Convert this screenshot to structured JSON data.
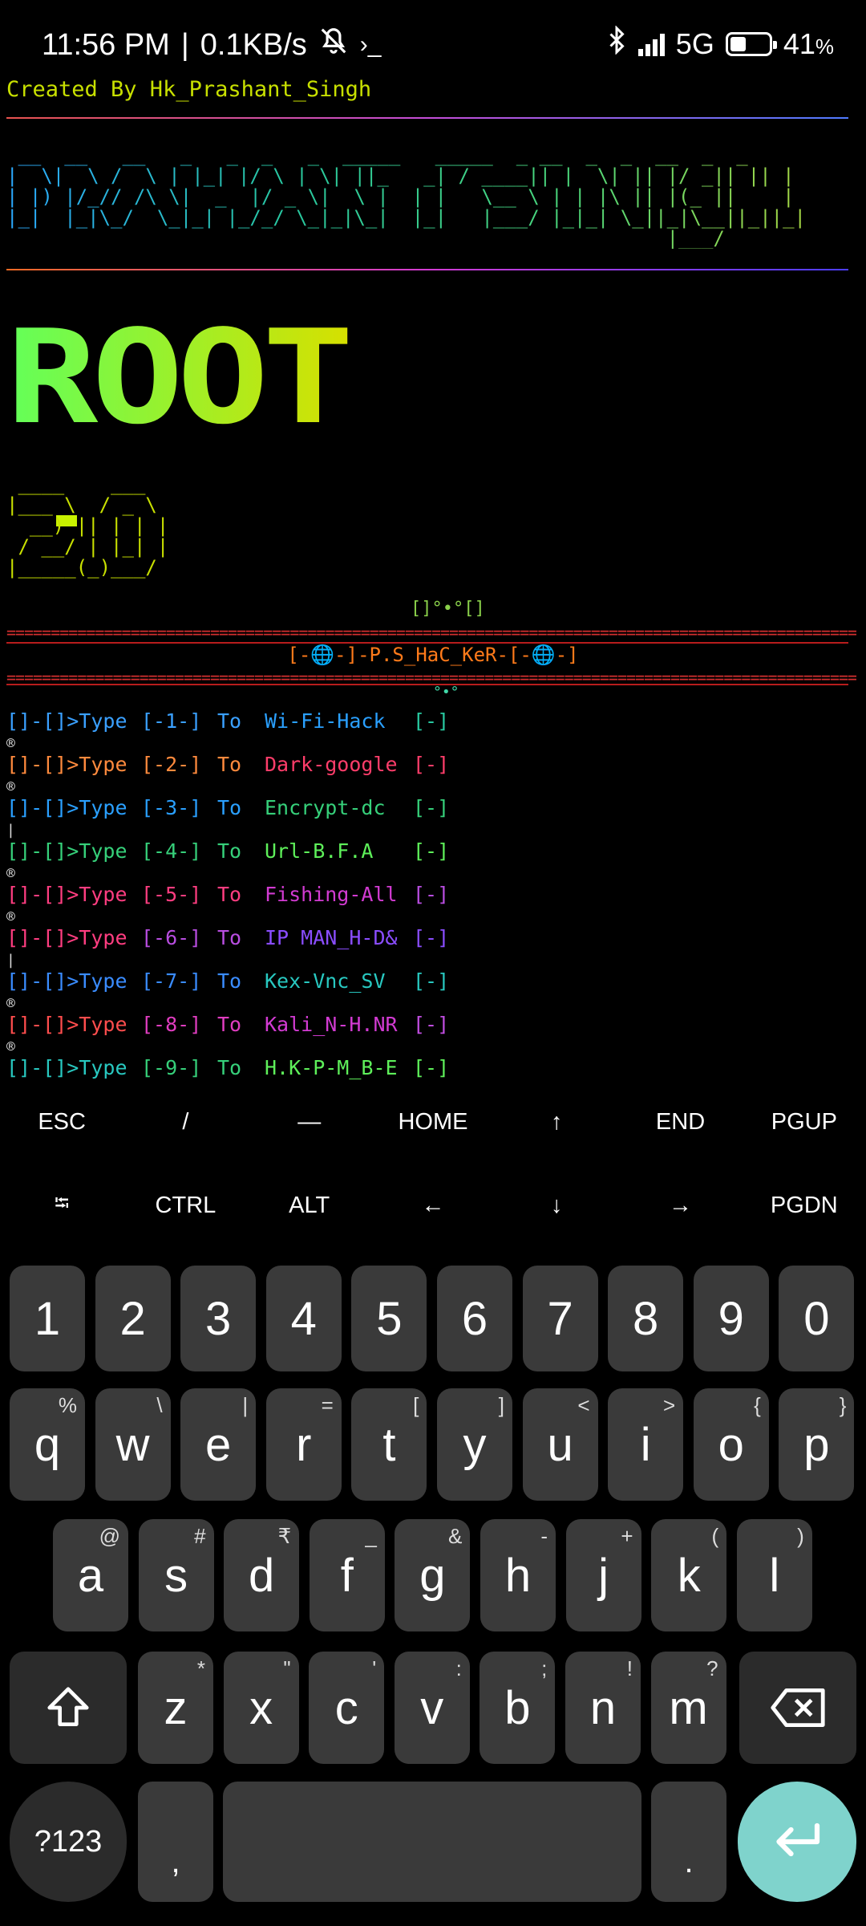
{
  "status_bar": {
    "time": "11:56 PM",
    "speed": "0.1KB/s",
    "network": "5G",
    "battery": "41",
    "battery_pct_symbol": "%",
    "battery_level": 0.41,
    "icons": [
      "mute-icon",
      "terminal-icon",
      "bluetooth-icon",
      "signal-icon",
      "battery-icon"
    ]
  },
  "terminal": {
    "credit": "Created By Hk_Prashant_Singh",
    "banner_ascii": " __  __   __   _   _  _   _  _____   _____  _ __  _  _  __  _  _ \n|  \\|  \\ /  \\ | |_| |/ \\ | \\| ||_   _| / ____|| |  \\| || |/ _|| || |\n| |) |/_// /\\ \\|  _  |/ _ \\|  \\ |  | |   \\__ \\ | | |\\ || |(_ ||    |\n|_|  |_|\\_/  \\_|_| |_/_/ \\_|_|\\_|  |_|   |___/ |_|_| \\_||_|\\__||_||_|\n                                                         |___/       ",
    "root_text": "ROOT",
    "version_ascii": " ____    ___  \n|___ \\  / _ \\ \n  __) || | | |\n / __/ | |_| |\n|_____(_)___/ ",
    "deco_top": "[]°•°[]",
    "separator": "==============================================================================================================",
    "header": "[-🌐-]-P.S_HaC_KeR-[-🌐-]",
    "deco_bottom": "°•°",
    "menu": [
      {
        "prefix": "[]-[]>Type",
        "num": "[-1-]",
        "to": "To",
        "name": "Wi-Fi-Hack",
        "end": "[-]",
        "mark": "®"
      },
      {
        "prefix": "[]-[]>Type",
        "num": "[-2-]",
        "to": "To",
        "name": "Dark-google",
        "end": "[-]",
        "mark": "®"
      },
      {
        "prefix": "[]-[]>Type",
        "num": "[-3-]",
        "to": "To",
        "name": "Encrypt-dc",
        "end": "[-]",
        "mark": "|"
      },
      {
        "prefix": "[]-[]>Type",
        "num": "[-4-]",
        "to": "To",
        "name": "Url-B.F.A",
        "end": "[-]",
        "mark": "®"
      },
      {
        "prefix": "[]-[]>Type",
        "num": "[-5-]",
        "to": "To",
        "name": "Fishing-All",
        "end": "[-]",
        "mark": "®"
      },
      {
        "prefix": "[]-[]>Type",
        "num": "[-6-]",
        "to": "To",
        "name": "IP MAN_H-D&",
        "end": "[-]",
        "mark": "|"
      },
      {
        "prefix": "[]-[]>Type",
        "num": "[-7-]",
        "to": "To",
        "name": "Kex-Vnc_SV",
        "end": "[-]",
        "mark": "®"
      },
      {
        "prefix": "[]-[]>Type",
        "num": "[-8-]",
        "to": "To",
        "name": "Kali_N-H.NR",
        "end": "[-]",
        "mark": "®"
      },
      {
        "prefix": "[]-[]>Type",
        "num": "[-9-]",
        "to": "To",
        "name": "H.K-P-M_B-E",
        "end": "[-]",
        "mark": ""
      }
    ]
  },
  "extra_keys": {
    "row1": [
      "ESC",
      "/",
      "—",
      "HOME",
      "↑",
      "END",
      "PGUP"
    ],
    "row2": [
      "⭾",
      "CTRL",
      "ALT",
      "←",
      "↓",
      "→",
      "PGDN"
    ]
  },
  "keyboard": {
    "numbers": [
      "1",
      "2",
      "3",
      "4",
      "5",
      "6",
      "7",
      "8",
      "9",
      "0"
    ],
    "row_q": [
      [
        "q",
        "%"
      ],
      [
        "w",
        "\\"
      ],
      [
        "e",
        "|"
      ],
      [
        "r",
        "="
      ],
      [
        "t",
        "["
      ],
      [
        "y",
        "]"
      ],
      [
        "u",
        "<"
      ],
      [
        "i",
        ">"
      ],
      [
        "o",
        "{"
      ],
      [
        "p",
        "}"
      ]
    ],
    "row_a": [
      [
        "a",
        "@"
      ],
      [
        "s",
        "#"
      ],
      [
        "d",
        "₹"
      ],
      [
        "f",
        "_"
      ],
      [
        "g",
        "&"
      ],
      [
        "h",
        "-"
      ],
      [
        "j",
        "+"
      ],
      [
        "k",
        "("
      ],
      [
        "l",
        ")"
      ]
    ],
    "row_z": [
      [
        "z",
        "*"
      ],
      [
        "x",
        "\""
      ],
      [
        "c",
        "'"
      ],
      [
        "v",
        ":"
      ],
      [
        "b",
        ";"
      ],
      [
        "n",
        "!"
      ],
      [
        "m",
        "?"
      ]
    ],
    "symbols_key": "?123",
    "comma": ",",
    "period": "."
  }
}
